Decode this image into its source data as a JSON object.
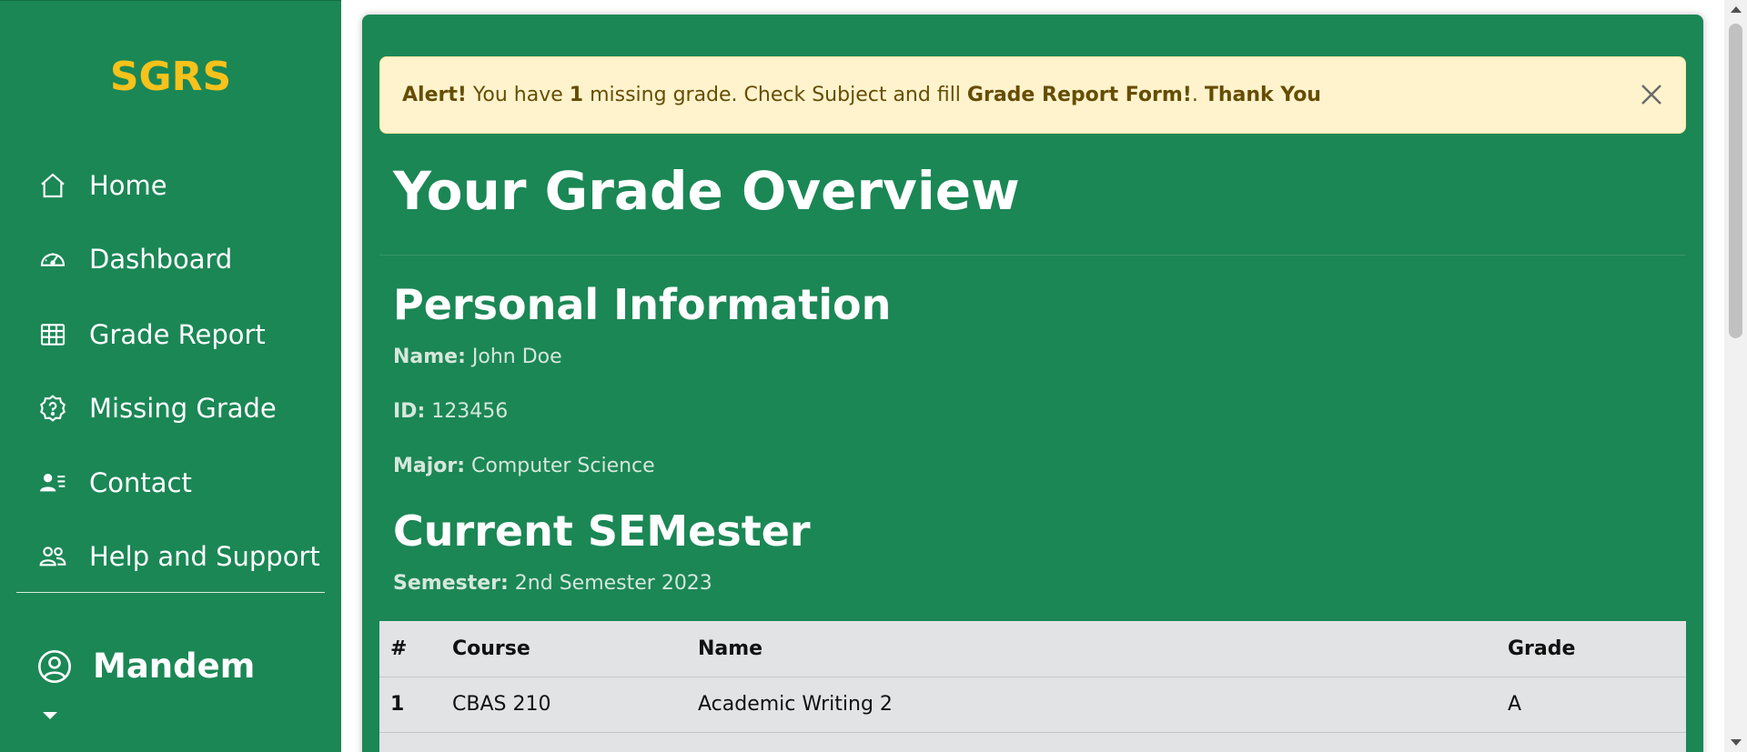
{
  "sidebar": {
    "brand": "SGRS",
    "items": [
      {
        "label": "Home",
        "icon": "home-icon"
      },
      {
        "label": "Dashboard",
        "icon": "speedometer-icon"
      },
      {
        "label": "Grade Report",
        "icon": "table-icon"
      },
      {
        "label": "Missing Grade",
        "icon": "question-badge-icon"
      },
      {
        "label": "Contact",
        "icon": "person-lines-icon"
      },
      {
        "label": "Help and Support",
        "icon": "people-icon"
      }
    ],
    "user": {
      "name": "Mandem",
      "icon": "person-circle-icon"
    }
  },
  "alert": {
    "prefix": "Alert!",
    "text1": " You have ",
    "count": "1",
    "text2": " missing grade. Check Subject and fill ",
    "form": "Grade Report Form!",
    "text3": ". ",
    "thanks": "Thank You"
  },
  "main": {
    "title": "Your Grade Overview",
    "personal_heading": "Personal Information",
    "name_label": "Name:",
    "name_value": " John Doe",
    "id_label": "ID:",
    "id_value": " 123456",
    "major_label": "Major:",
    "major_value": " Computer Science",
    "semester_heading": "Current SEMester",
    "semester_label": "Semester:",
    "semester_value": " 2nd Semester 2023"
  },
  "table": {
    "headers": [
      "#",
      "Course",
      "Name",
      "Grade"
    ],
    "rows": [
      [
        "1",
        "CBAS 210",
        "Academic Writing 2",
        "A"
      ]
    ]
  },
  "colors": {
    "sidebar_bg": "#1b8755",
    "brand": "#f6c21b",
    "alert_bg": "#fff3cd",
    "alert_text": "#664d03",
    "table_bg": "#e2e3e5"
  }
}
